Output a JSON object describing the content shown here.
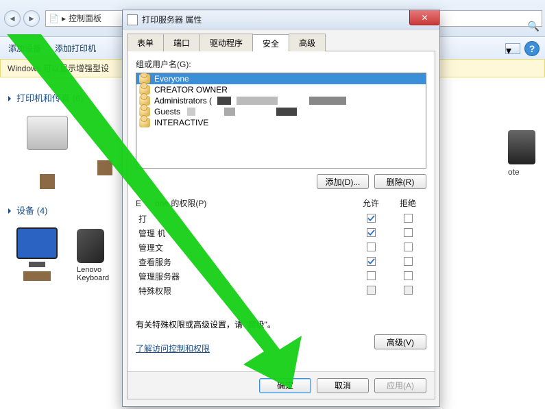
{
  "explorer": {
    "breadcrumb_icon": "📄",
    "crumb1": "▸",
    "crumb2": "控制面板",
    "add_device": "添加设备",
    "add_printer": "添加打印机",
    "info_bar": "Windows 可以显示增强型设",
    "group1_title": "打印机和传真 (6)",
    "group2_title": "设备 (4)",
    "device_labels": [
      "Lenovo",
      "Keyboard"
    ],
    "note_label": "ote"
  },
  "dialog": {
    "title": "打印服务器 属性",
    "tabs": [
      "表单",
      "端口",
      "驱动程序",
      "安全",
      "高级"
    ],
    "active_tab": 3,
    "group_label": "组或用户名(G):",
    "users": [
      "Everyone",
      "CREATOR OWNER",
      "Administrators (",
      "Guests",
      "INTERACTIVE"
    ],
    "add_btn": "添加(D)...",
    "remove_btn": "删除(R)",
    "perm_title_prefix": "E",
    "perm_title_suffix": "one 的权限(P)",
    "allow": "允许",
    "deny": "拒绝",
    "permissions": [
      {
        "name": "打",
        "allow": true,
        "deny": false
      },
      {
        "name": "管理    机",
        "allow": true,
        "deny": false
      },
      {
        "name": "管理文",
        "allow": false,
        "deny": false
      },
      {
        "name": "查看服务",
        "allow": true,
        "deny": false
      },
      {
        "name": "管理服务器",
        "allow": false,
        "deny": false
      },
      {
        "name": "特殊权限",
        "allow": false,
        "deny": false
      }
    ],
    "note_text": "有关特殊权限或高级设置，请    \"高级\"。",
    "advanced_btn": "高级(V)",
    "link": "了解访问控制和权限",
    "ok": "确定",
    "cancel": "取消",
    "apply": "应用(A)"
  }
}
